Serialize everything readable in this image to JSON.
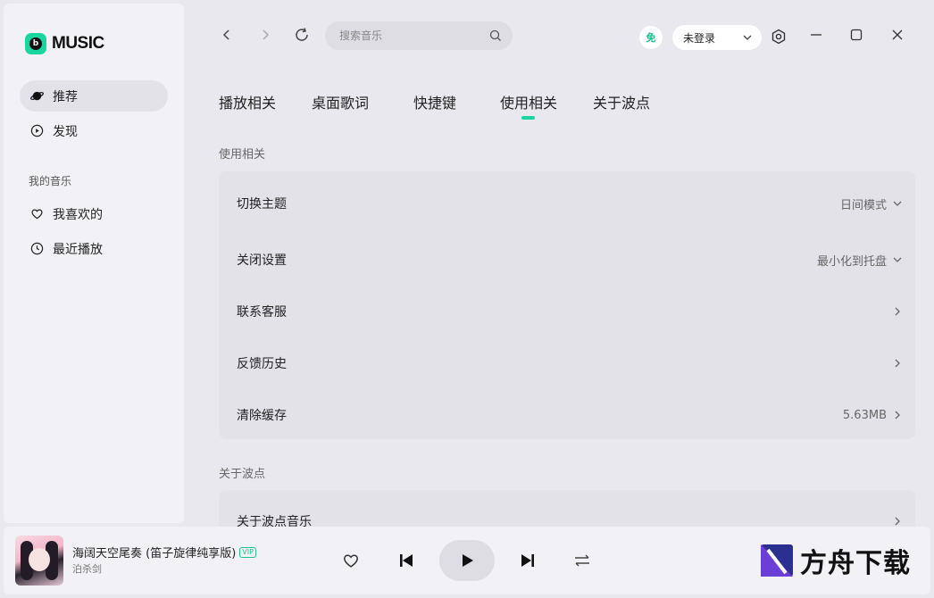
{
  "app": {
    "logo_text": "MUSIC",
    "accent": "#19d6a0"
  },
  "sidebar": {
    "items": [
      {
        "label": "推荐",
        "icon": "planet-icon",
        "active": true
      },
      {
        "label": "发现",
        "icon": "play-circle-icon",
        "active": false
      }
    ],
    "section_label": "我的音乐",
    "my_music": [
      {
        "label": "我喜欢的",
        "icon": "heart-icon"
      },
      {
        "label": "最近播放",
        "icon": "clock-icon"
      }
    ]
  },
  "topbar": {
    "search_placeholder": "搜索音乐",
    "free_badge": "免",
    "login_label": "未登录"
  },
  "tabs": [
    {
      "label": "播放相关",
      "active": false
    },
    {
      "label": "桌面歌词",
      "active": false
    },
    {
      "label": "快捷键",
      "active": false
    },
    {
      "label": "使用相关",
      "active": true
    },
    {
      "label": "关于波点",
      "active": false
    }
  ],
  "usage": {
    "title": "使用相关",
    "rows": [
      {
        "label": "切换主题",
        "value": "日间模式",
        "control": "dropdown"
      },
      {
        "label": "关闭设置",
        "value": "最小化到托盘",
        "control": "dropdown"
      },
      {
        "label": "联系客服",
        "value": "",
        "control": "arrow"
      },
      {
        "label": "反馈历史",
        "value": "",
        "control": "arrow"
      },
      {
        "label": "清除缓存",
        "value": "5.63MB",
        "control": "arrow"
      }
    ]
  },
  "about": {
    "title": "关于波点",
    "rows": [
      {
        "label": "关于波点音乐",
        "value": "",
        "control": "arrow"
      }
    ]
  },
  "player": {
    "song_title": "海阔天空尾奏 (笛子旋律纯享版)",
    "vip_badge": "VIP",
    "artist": "泊杀剑"
  },
  "watermark": {
    "text": "方舟下载"
  }
}
